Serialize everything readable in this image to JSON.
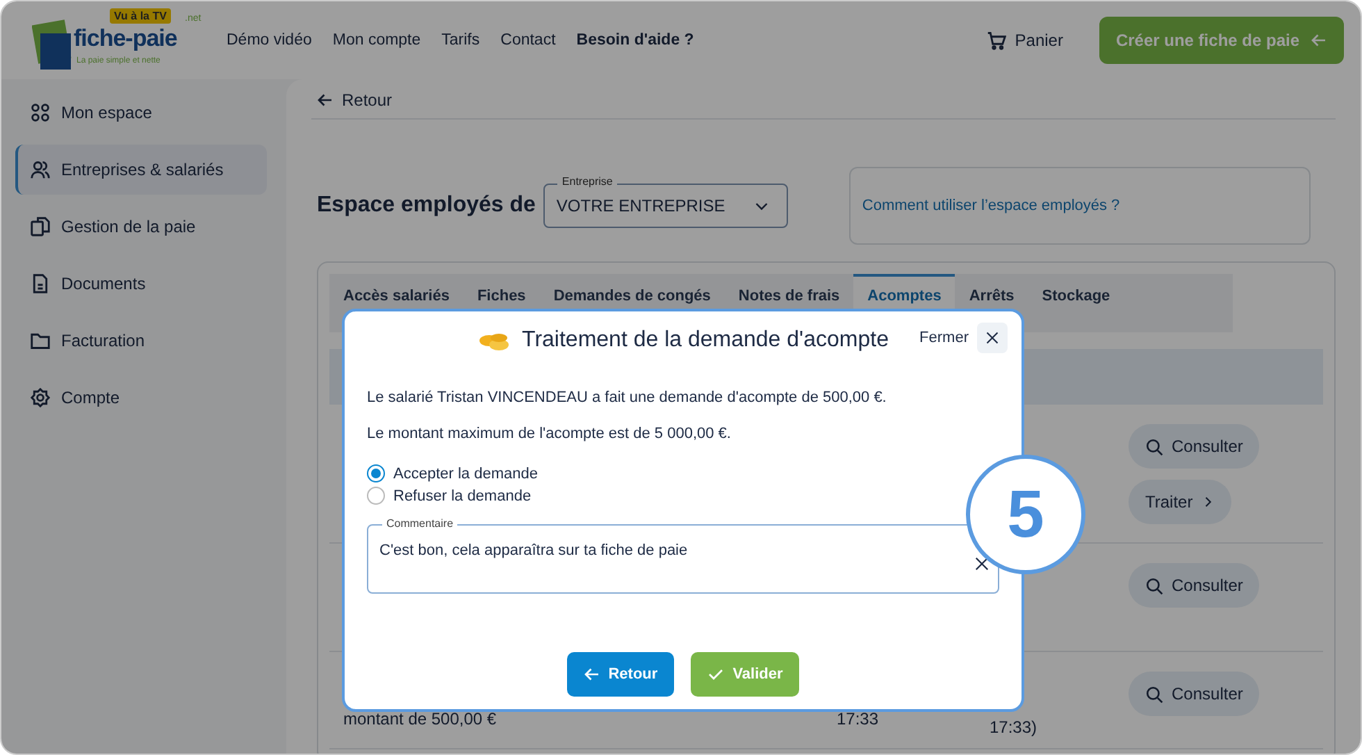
{
  "header": {
    "logo": {
      "badge": "Vu à la TV",
      "name": "fiche-paie",
      "suffix": ".net",
      "tagline": "La paie simple et nette"
    },
    "nav": [
      {
        "label": "Démo vidéo",
        "bold": false
      },
      {
        "label": "Mon compte",
        "bold": false
      },
      {
        "label": "Tarifs",
        "bold": false
      },
      {
        "label": "Contact",
        "bold": false
      },
      {
        "label": "Besoin d'aide ?",
        "bold": true
      }
    ],
    "cart": "Panier",
    "cta": "Créer une fiche de paie"
  },
  "sidebar": {
    "items": [
      {
        "label": "Mon espace",
        "selected": false
      },
      {
        "label": "Entreprises & salariés",
        "selected": true
      },
      {
        "label": "Gestion de la paie",
        "selected": false
      },
      {
        "label": "Documents",
        "selected": false
      },
      {
        "label": "Facturation",
        "selected": false
      },
      {
        "label": "Compte",
        "selected": false
      }
    ]
  },
  "main": {
    "back": "Retour",
    "title": "Espace employés de",
    "company_select": {
      "label": "Entreprise",
      "value": "VOTRE ENTREPRISE"
    },
    "help_link": "Comment utiliser l’espace employés ?",
    "tabs": [
      {
        "label": "Accès salariés",
        "selected": false
      },
      {
        "label": "Fiches",
        "selected": false
      },
      {
        "label": "Demandes de congés",
        "selected": false
      },
      {
        "label": "Notes de frais",
        "selected": false
      },
      {
        "label": "Acomptes",
        "selected": true
      },
      {
        "label": "Arrêts",
        "selected": false
      },
      {
        "label": "Stockage",
        "selected": false
      }
    ],
    "rows": [
      {
        "actions": [
          "Consulter",
          "Traiter"
        ]
      },
      {
        "actions": [
          "Consulter"
        ]
      },
      {
        "text": "montant de 500,00 €",
        "time": "17:33",
        "date": "17:33)",
        "actions": [
          "Consulter"
        ]
      }
    ]
  },
  "dialog": {
    "title": "Traitement de la demande d'acompte",
    "close": "Fermer",
    "paragraphs": [
      "Le salarié Tristan VINCENDEAU a fait une demande d'acompte de 500,00 €.",
      "Le montant maximum de l'acompte est de 5 000,00 €."
    ],
    "options": [
      {
        "label": "Accepter la demande",
        "selected": true
      },
      {
        "label": "Refuser la demande",
        "selected": false
      }
    ],
    "comment": {
      "label": "Commentaire",
      "value": "C'est bon, cela apparaîtra sur ta fiche de paie"
    },
    "buttons": [
      {
        "label": "Retour",
        "kind": "back"
      },
      {
        "label": "Valider",
        "kind": "confirm"
      }
    ]
  },
  "step_badge": "5"
}
